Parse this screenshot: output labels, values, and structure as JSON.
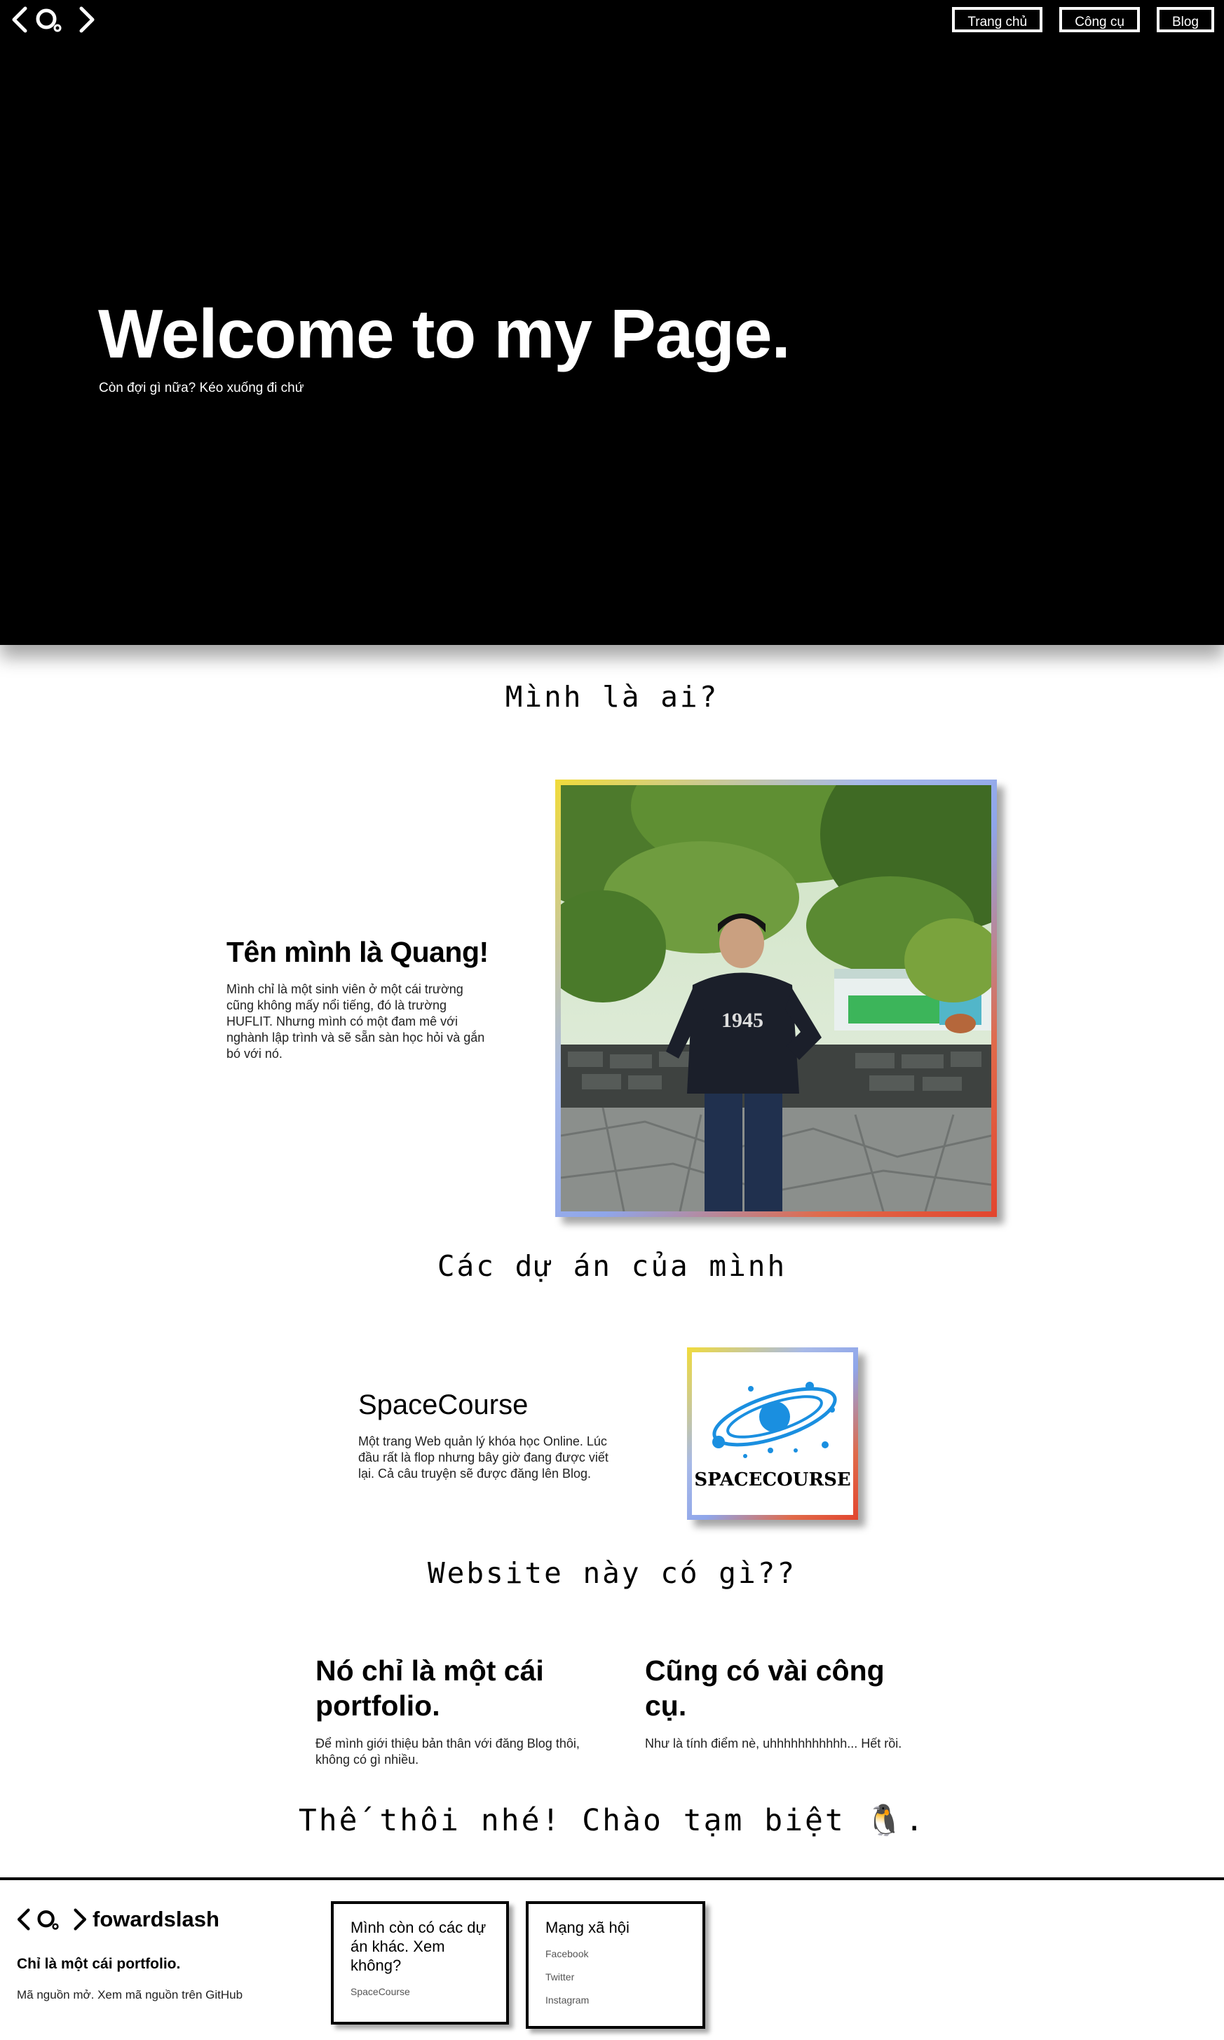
{
  "nav": {
    "items": [
      {
        "label": "Trang chủ"
      },
      {
        "label": "Công cụ"
      },
      {
        "label": "Blog"
      }
    ]
  },
  "hero": {
    "title": "Welcome to my Page.",
    "subtitle": "Còn đợi gì nữa? Kéo xuống đi chứ"
  },
  "about": {
    "heading": "Mình là ai?",
    "name": "Tên mình là Quang!",
    "description": "Mình chỉ là một sinh viên ở một cái trường cũng không mấy nổi tiếng, đó là trường HUFLIT. Nhưng mình có một đam mê với nghành lập trình và sẽ sẵn sàn học hỏi và gắn bó với nó.",
    "shirt_text": "1945"
  },
  "projects": {
    "heading": "Các dự án của mình",
    "items": [
      {
        "name": "SpaceCourse",
        "description": "Một trang Web quản lý khóa học Online. Lúc đầu rất là flop nhưng bây giờ đang được viết lại. Cả câu truyện sẽ được đăng lên Blog.",
        "logo_text": "SPACECOURSE"
      }
    ]
  },
  "features": {
    "heading": "Website này có gì??",
    "items": [
      {
        "title": "Nó chỉ là một cái portfolio.",
        "description": "Để mình giới thiệu bản thân với đăng Blog thôi, không có gì nhiều."
      },
      {
        "title": "Cũng có vài công cụ.",
        "description": "Như là tính điểm nè, uhhhhhhhhhhh... Hết rồi."
      }
    ]
  },
  "goodbye": {
    "text": "Thế thôi nhé! Chào tạm biệt 🐧."
  },
  "footer": {
    "brand": "fowardslash",
    "tagline": "Chỉ là một cái portfolio.",
    "source": "Mã nguồn mở. Xem mã nguồn trên GitHub",
    "projects_card": {
      "title": "Mình còn có các dự án khác. Xem không?",
      "links": [
        "SpaceCourse"
      ]
    },
    "social_card": {
      "title": "Mạng xã hội",
      "links": [
        "Facebook",
        "Twitter",
        "Instagram"
      ]
    }
  },
  "colors": {
    "hero_bg": "#000000",
    "frame_gradient_start": "#f1db3a",
    "frame_gradient_mid": "#8fa6ea",
    "frame_gradient_end": "#e2452e",
    "spacecourse_blue": "#1a8fe0"
  }
}
